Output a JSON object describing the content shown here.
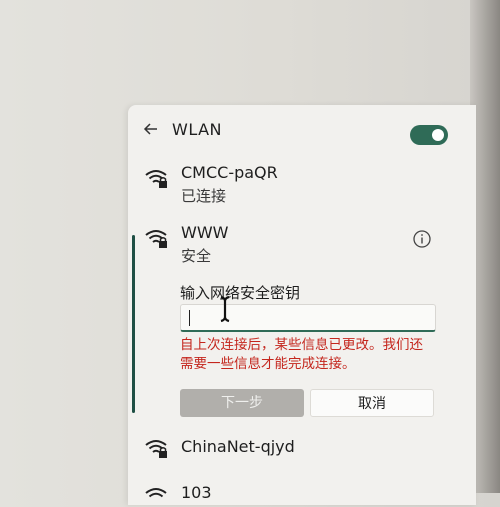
{
  "panel": {
    "title": "WLAN",
    "toggle_on": true,
    "accent_color": "#2f6b57"
  },
  "networks": [
    {
      "name": "CMCC-paQR",
      "status": "已连接",
      "icon": "wifi-secured-icon"
    },
    {
      "name": "WWW",
      "status": "安全",
      "icon": "wifi-secured-icon",
      "selected": true
    },
    {
      "name": "ChinaNet-qjyd",
      "icon": "wifi-secured-icon"
    },
    {
      "name": "103",
      "icon": "wifi-secured-icon"
    }
  ],
  "connect_form": {
    "prompt": "输入网络安全密钥",
    "password_value": "",
    "error_message": "自上次连接后，某些信息已更改。我们还需要一些信息才能完成连接。",
    "error_color": "#c4261d",
    "next_label": "下一步",
    "cancel_label": "取消"
  }
}
